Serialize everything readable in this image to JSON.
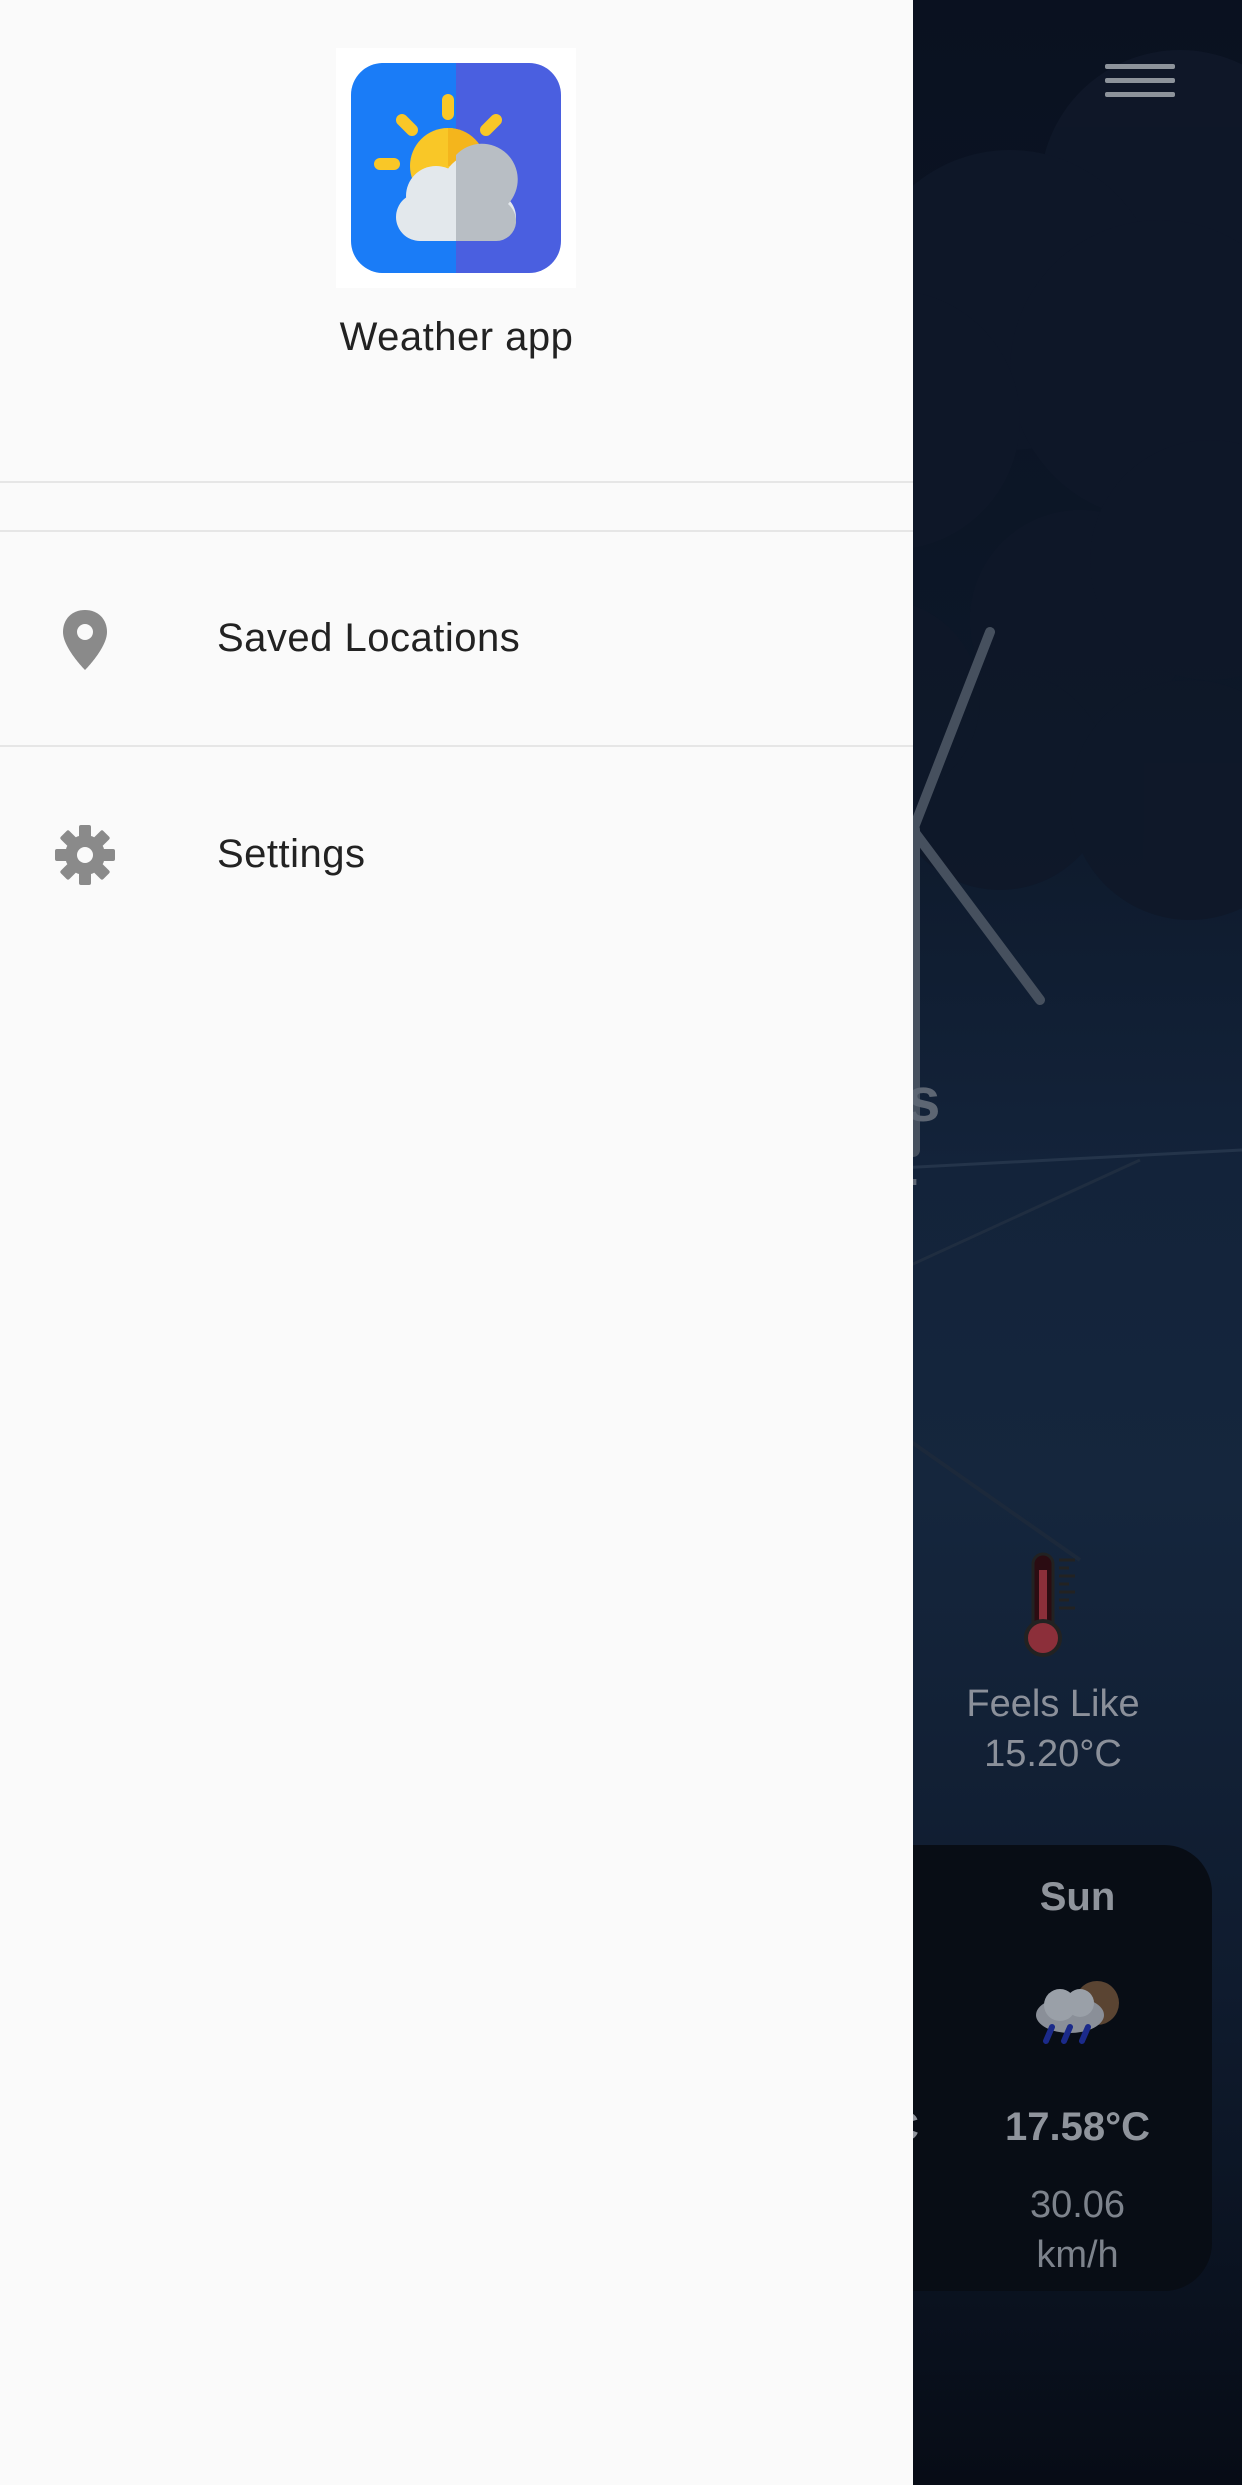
{
  "drawer": {
    "app_name": "Weather app",
    "items": [
      {
        "label": "Saved Locations",
        "icon": "location-pin-icon"
      },
      {
        "label": "Settings",
        "icon": "gear-icon"
      }
    ]
  },
  "background": {
    "partial_title_fragment": "s",
    "partial_subtitle_fragment": ".",
    "feels_like": {
      "label": "Feels Like",
      "value": "15.20°C"
    },
    "forecast": {
      "previous_temp_fragment": "C",
      "day": "Sun",
      "temperature": "17.58°C",
      "wind": "30.06\nkm/h",
      "icon": "rain-cloud-moon-icon"
    }
  },
  "colors": {
    "drawer_bg": "#fafafa",
    "logo_blue": "#1a7cf7",
    "logo_indigo": "#4a5fe0",
    "sun_yellow": "#f9c727",
    "icon_gray": "#8a8a8a"
  }
}
